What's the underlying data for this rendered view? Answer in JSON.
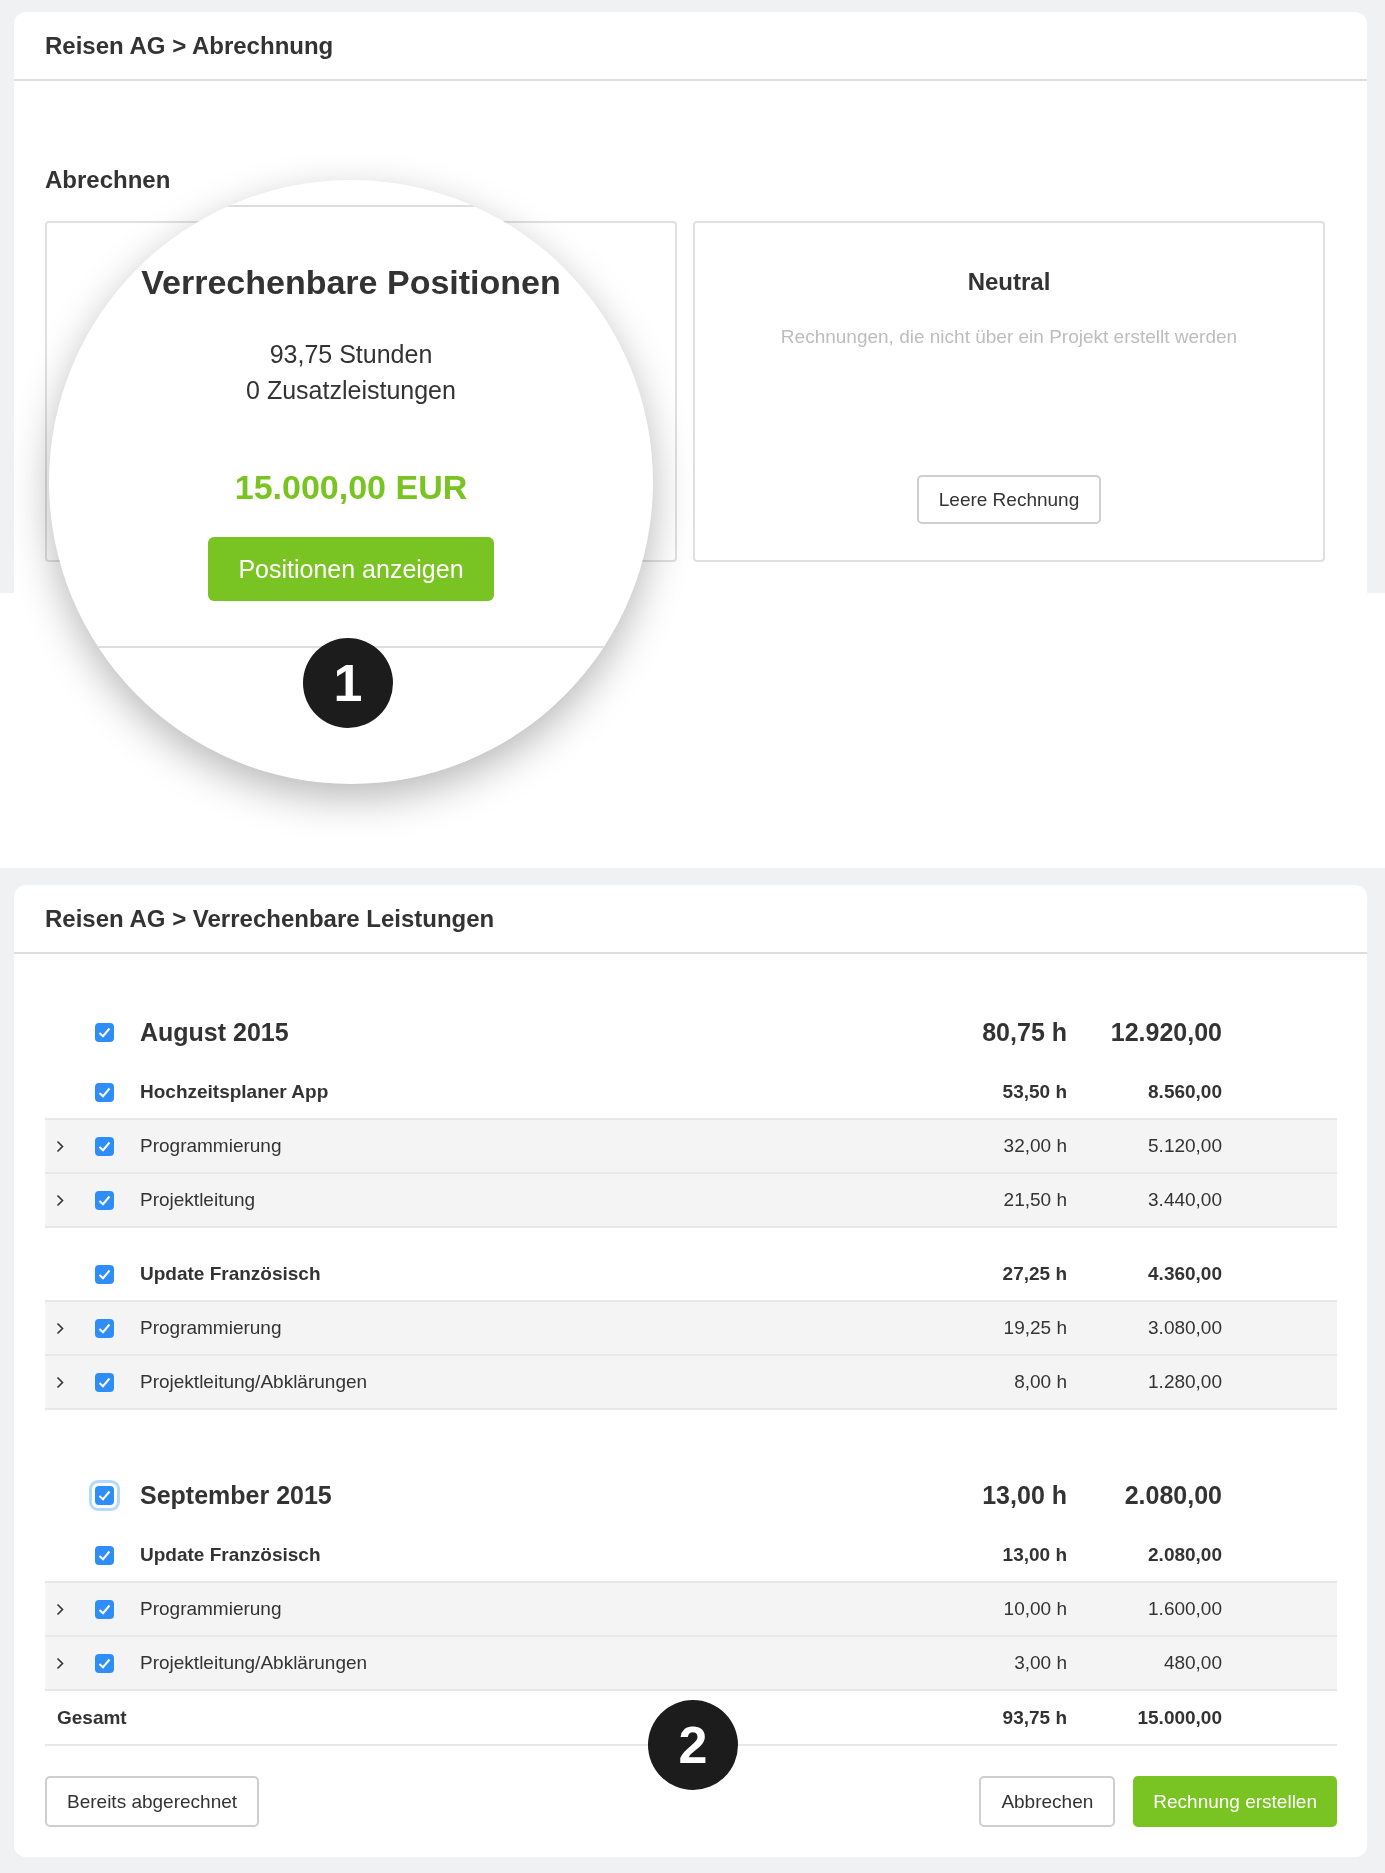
{
  "top_panel": {
    "breadcrumb": "Reisen AG > Abrechnung",
    "section_title": "Abrechnen",
    "neutral_card": {
      "title": "Neutral",
      "description": "Rechnungen, die nicht über ein Projekt erstellt werden",
      "button": "Leere Rechnung"
    }
  },
  "magnifier": {
    "title": "Verrechenbare Positionen",
    "lines": [
      "93,75 Stunden",
      "0 Zusatzleistungen"
    ],
    "amount": "15.000,00 EUR",
    "button": "Positionen anzeigen",
    "badge": "1"
  },
  "bottom_panel": {
    "breadcrumb": "Reisen AG > Verrechenbare Leistungen",
    "months": [
      {
        "label": "August 2015",
        "checked": true,
        "focused": false,
        "hours": "80,75 h",
        "amount": "12.920,00",
        "projects": [
          {
            "label": "Hochzeitsplaner App",
            "checked": true,
            "hours": "53,50 h",
            "amount": "8.560,00",
            "items": [
              {
                "label": "Programmierung",
                "checked": true,
                "hours": "32,00 h",
                "amount": "5.120,00"
              },
              {
                "label": "Projektleitung",
                "checked": true,
                "hours": "21,50 h",
                "amount": "3.440,00"
              }
            ]
          },
          {
            "label": "Update Französisch",
            "checked": true,
            "hours": "27,25 h",
            "amount": "4.360,00",
            "items": [
              {
                "label": "Programmierung",
                "checked": true,
                "hours": "19,25 h",
                "amount": "3.080,00"
              },
              {
                "label": "Projektleitung/Abklärungen",
                "checked": true,
                "hours": "8,00 h",
                "amount": "1.280,00"
              }
            ]
          }
        ]
      },
      {
        "label": "September 2015",
        "checked": true,
        "focused": true,
        "hours": "13,00 h",
        "amount": "2.080,00",
        "projects": [
          {
            "label": "Update Französisch",
            "checked": true,
            "hours": "13,00 h",
            "amount": "2.080,00",
            "items": [
              {
                "label": "Programmierung",
                "checked": true,
                "hours": "10,00 h",
                "amount": "1.600,00"
              },
              {
                "label": "Projektleitung/Abklärungen",
                "checked": true,
                "hours": "3,00 h",
                "amount": "480,00"
              }
            ]
          }
        ]
      }
    ],
    "total": {
      "label": "Gesamt",
      "hours": "93,75 h",
      "amount": "15.000,00"
    },
    "buttons_left": [
      "Bereits abgerechnet"
    ],
    "buttons_right": [
      {
        "label": "Abbrechen",
        "kind": "secondary"
      },
      {
        "label": "Rechnung erstellen",
        "kind": "primary"
      }
    ],
    "badge": "2"
  }
}
